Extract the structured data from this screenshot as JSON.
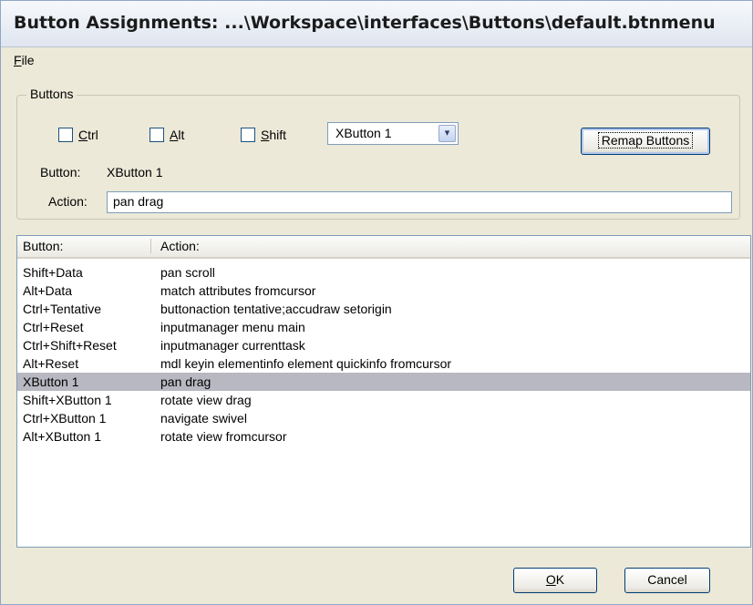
{
  "window": {
    "title": "Button Assignments: ...\\Workspace\\interfaces\\Buttons\\default.btnmenu"
  },
  "menubar": {
    "file": {
      "underline": "F",
      "rest": "ile"
    }
  },
  "buttons_group": {
    "legend": "Buttons",
    "ctrl": {
      "underline": "C",
      "rest": "trl",
      "checked": false
    },
    "alt": {
      "underline": "A",
      "rest": "lt",
      "checked": false
    },
    "shift": {
      "underline": "S",
      "rest": "hift",
      "checked": false
    },
    "button_select": {
      "value": "XButton 1",
      "arrow": "▾"
    },
    "remap_label": "Remap Buttons",
    "button_label": "Button:",
    "button_value": "XButton 1",
    "action_label": "Action:",
    "action_value": "pan drag"
  },
  "list": {
    "columns": [
      "Button:",
      "Action:"
    ],
    "rows": [
      {
        "button": "Shift+Data",
        "action": "pan scroll"
      },
      {
        "button": "Alt+Data",
        "action": "match attributes fromcursor"
      },
      {
        "button": "Ctrl+Tentative",
        "action": "buttonaction tentative;accudraw setorigin"
      },
      {
        "button": "Ctrl+Reset",
        "action": "inputmanager menu main"
      },
      {
        "button": "Ctrl+Shift+Reset",
        "action": "inputmanager currenttask"
      },
      {
        "button": "Alt+Reset",
        "action": "mdl keyin elementinfo element quickinfo fromcursor"
      },
      {
        "button": "XButton 1",
        "action": "pan drag",
        "selected": true
      },
      {
        "button": "Shift+XButton 1",
        "action": "rotate view drag"
      },
      {
        "button": "Ctrl+XButton 1",
        "action": "navigate swivel"
      },
      {
        "button": "Alt+XButton 1",
        "action": "rotate view fromcursor"
      }
    ]
  },
  "footer": {
    "ok": {
      "underline": "O",
      "rest": "K"
    },
    "cancel": "Cancel"
  },
  "colors": {
    "dialog_bg": "#ece9d8",
    "selected_row": "#b8b8c2",
    "outer_bg": "#c7d6ec"
  }
}
